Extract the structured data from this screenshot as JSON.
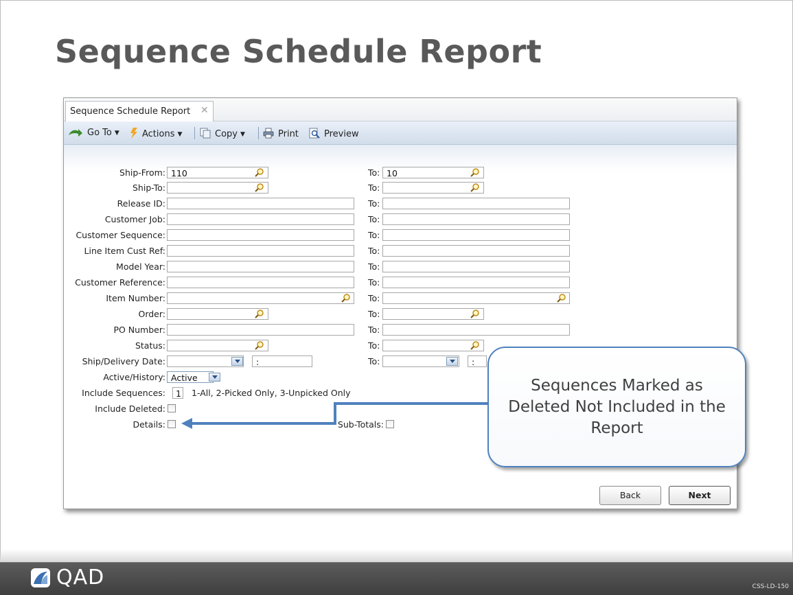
{
  "slide": {
    "title": "Sequence Schedule Report",
    "code": "CSS-LD-150",
    "logo_text": "QAD"
  },
  "tab": {
    "label": "Sequence Schedule Report"
  },
  "toolbar": {
    "goto": "Go To",
    "actions": "Actions",
    "copy": "Copy",
    "print": "Print",
    "preview": "Preview"
  },
  "form": {
    "to_label": "To:",
    "ship_from": {
      "label": "Ship-From:",
      "value": "110",
      "to_value": "10"
    },
    "ship_to": {
      "label": "Ship-To:",
      "value": "",
      "to_value": ""
    },
    "release_id": {
      "label": "Release ID:",
      "value": "",
      "to_value": ""
    },
    "customer_job": {
      "label": "Customer Job:",
      "value": "",
      "to_value": ""
    },
    "customer_sequence": {
      "label": "Customer Sequence:",
      "value": "",
      "to_value": ""
    },
    "line_item_cust_ref": {
      "label": "Line Item Cust Ref:",
      "value": "",
      "to_value": ""
    },
    "model_year": {
      "label": "Model Year:",
      "value": "",
      "to_value": ""
    },
    "customer_reference": {
      "label": "Customer Reference:",
      "value": "",
      "to_value": ""
    },
    "item_number": {
      "label": "Item Number:",
      "value": "",
      "to_value": ""
    },
    "order": {
      "label": "Order:",
      "value": "",
      "to_value": ""
    },
    "po_number": {
      "label": "PO Number:",
      "value": "",
      "to_value": ""
    },
    "status": {
      "label": "Status:",
      "value": "",
      "to_value": ""
    },
    "ship_delivery_date": {
      "label": "Ship/Delivery Date:",
      "date": "",
      "time": ":",
      "to_date": "",
      "to_time": ":"
    },
    "active_history": {
      "label": "Active/History:",
      "value": "Active"
    },
    "include_sequences": {
      "label": "Include Sequences:",
      "value": "1",
      "hint": "1-All, 2-Picked Only, 3-Unpicked Only"
    },
    "include_deleted": {
      "label": "Include Deleted:",
      "checked": false
    },
    "details": {
      "label": "Details:",
      "checked": false
    },
    "sub_totals": {
      "label": "Sub-Totals:",
      "checked": false
    }
  },
  "buttons": {
    "back": "Back",
    "next": "Next"
  },
  "callout": {
    "text": "Sequences Marked as Deleted Not Included in the Report"
  },
  "colors": {
    "callout_border": "#4f81bd",
    "arrow": "#4f81bd",
    "footer": "#4a4a4a"
  }
}
